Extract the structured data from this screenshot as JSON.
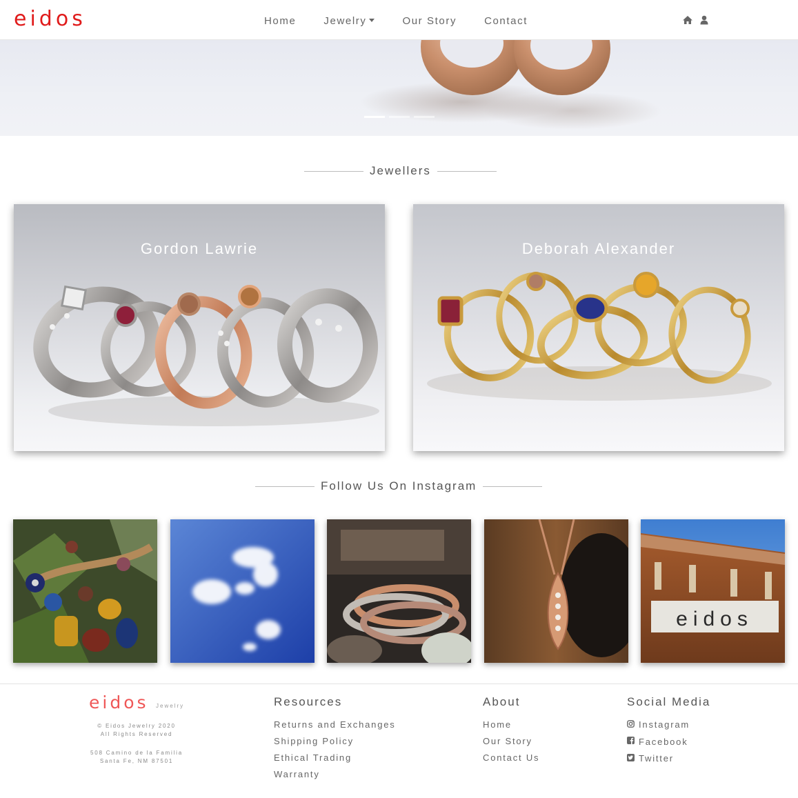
{
  "brand": {
    "name": "eidos",
    "color": "#e01b1b"
  },
  "nav": {
    "links": [
      "Home",
      "Jewelry",
      "Our Story",
      "Contact"
    ],
    "icons": [
      "home-icon",
      "user-icon"
    ]
  },
  "hero": {
    "slides": 3,
    "active_slide": 1
  },
  "jewellers": {
    "title": "Jewellers",
    "cards": [
      {
        "name": "Gordon Lawrie"
      },
      {
        "name": "Deborah Alexander"
      }
    ]
  },
  "instagram": {
    "title": "Follow Us On Instagram",
    "images": [
      "beaded-necklace-photo",
      "sky-clouds-photo",
      "stacked-rings-photo",
      "rose-gold-pendant-photo",
      "eidos-storefront-photo"
    ],
    "storefront_sign": "eidos"
  },
  "footer": {
    "brand": "eidos",
    "brand_sub": "Jewelry",
    "brand_color": "#ef5757",
    "copyright": "© Eidos Jewelry 2020",
    "rights": "All Rights Reserved",
    "address1": "508 Camino de la Familia",
    "address2": "Santa Fe, NM 87501",
    "resources": {
      "title": "Resources",
      "links": [
        "Returns and Exchanges",
        "Shipping Policy",
        "Ethical Trading",
        "Warranty"
      ]
    },
    "about": {
      "title": "About",
      "links": [
        "Home",
        "Our Story",
        "Contact Us"
      ]
    },
    "social": {
      "title": "Social Media",
      "links": [
        "Instagram",
        "Facebook",
        "Twitter"
      ],
      "icons": [
        "instagram-icon",
        "facebook-icon",
        "twitter-icon"
      ]
    }
  }
}
